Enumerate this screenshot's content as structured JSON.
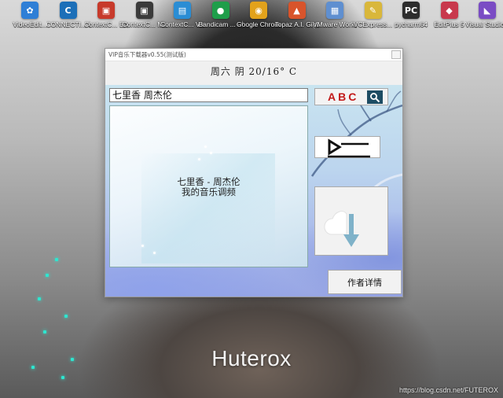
{
  "desktop": {
    "icons": [
      {
        "label": "VideoEdit...",
        "icon": "video-edit-icon",
        "color": "#2f7fd6",
        "glyph": "✿"
      },
      {
        "label": "CONNECTI... Client",
        "icon": "connect-client-icon",
        "color": "#1c6fb8",
        "glyph": "C"
      },
      {
        "label": "ContextC... Engine",
        "icon": "context-engine-icon",
        "color": "#c73a2b",
        "glyph": "▣"
      },
      {
        "label": "ContextC... Master",
        "icon": "context-master-icon",
        "color": "#3a3a3a",
        "glyph": "▣"
      },
      {
        "label": "ContextC... Viewer",
        "icon": "context-viewer-icon",
        "color": "#2a8dd4",
        "glyph": "▤"
      },
      {
        "label": "Bandicam ... - 快捷方式",
        "icon": "bandicam-icon",
        "color": "#1e9e4a",
        "glyph": "●"
      },
      {
        "label": "Google Chrome",
        "icon": "chrome-icon",
        "color": "#e2a21b",
        "glyph": "◉"
      },
      {
        "label": "Topaz A.I. Gigapixel",
        "icon": "topaz-icon",
        "color": "#d8542b",
        "glyph": "▲"
      },
      {
        "label": "VMware Workstati...",
        "icon": "vmware-icon",
        "color": "#5f8fd0",
        "glyph": "▦"
      },
      {
        "label": "VCExpress...",
        "icon": "vcexpress-icon",
        "color": "#d9b73b",
        "glyph": "✎"
      },
      {
        "label": "pycharm64",
        "icon": "pycharm-icon",
        "color": "#2c2c2c",
        "glyph": "PC"
      },
      {
        "label": "EditPlus 5",
        "icon": "editplus-icon",
        "color": "#c8394d",
        "glyph": "◆"
      },
      {
        "label": "Visual Studio 2019",
        "icon": "visual-studio-icon",
        "color": "#7a4cc4",
        "glyph": "◣"
      }
    ],
    "wallpaper_text": "Huterox",
    "watermark": "https://blog.csdn.net/FUTEROX"
  },
  "window": {
    "title": "VIP音乐下载器v0.55(测试版)",
    "weather": "周六  阴  20/16° C",
    "search_value": "七里香 周杰伦",
    "display_line1": "七里香 - 周杰伦",
    "display_line2": "我的音乐调频",
    "search_button_text": "ABC",
    "about_button_label": "作者详情"
  },
  "colors": {
    "accent_teal": "#2ee6d0",
    "search_text_red": "#c21a1a",
    "magnifier_bg": "#1d4c63",
    "arrow_blue": "#7fb2c9"
  }
}
